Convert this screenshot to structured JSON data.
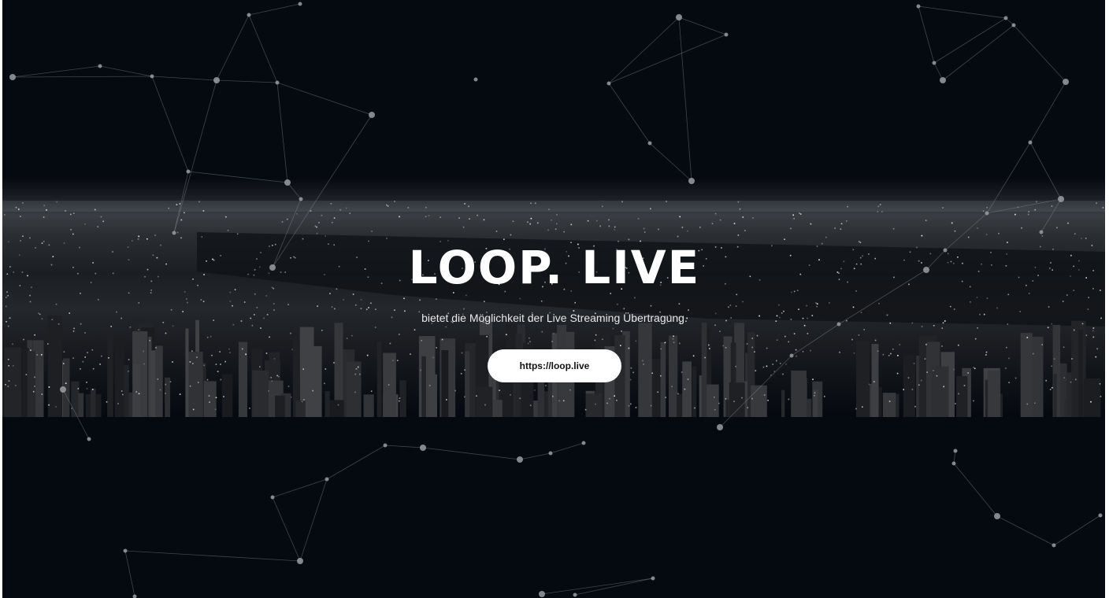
{
  "hero": {
    "title": "LOOP. LIVE",
    "tagline": "bietet die Möglichkeit der Live Streaming Übertragung.",
    "cta_label": "https://loop.live"
  },
  "colors": {
    "background": "#050a10",
    "text": "#ffffff",
    "button_bg": "#ffffff",
    "button_text": "#111111",
    "network_lines": "#8a8d92"
  }
}
